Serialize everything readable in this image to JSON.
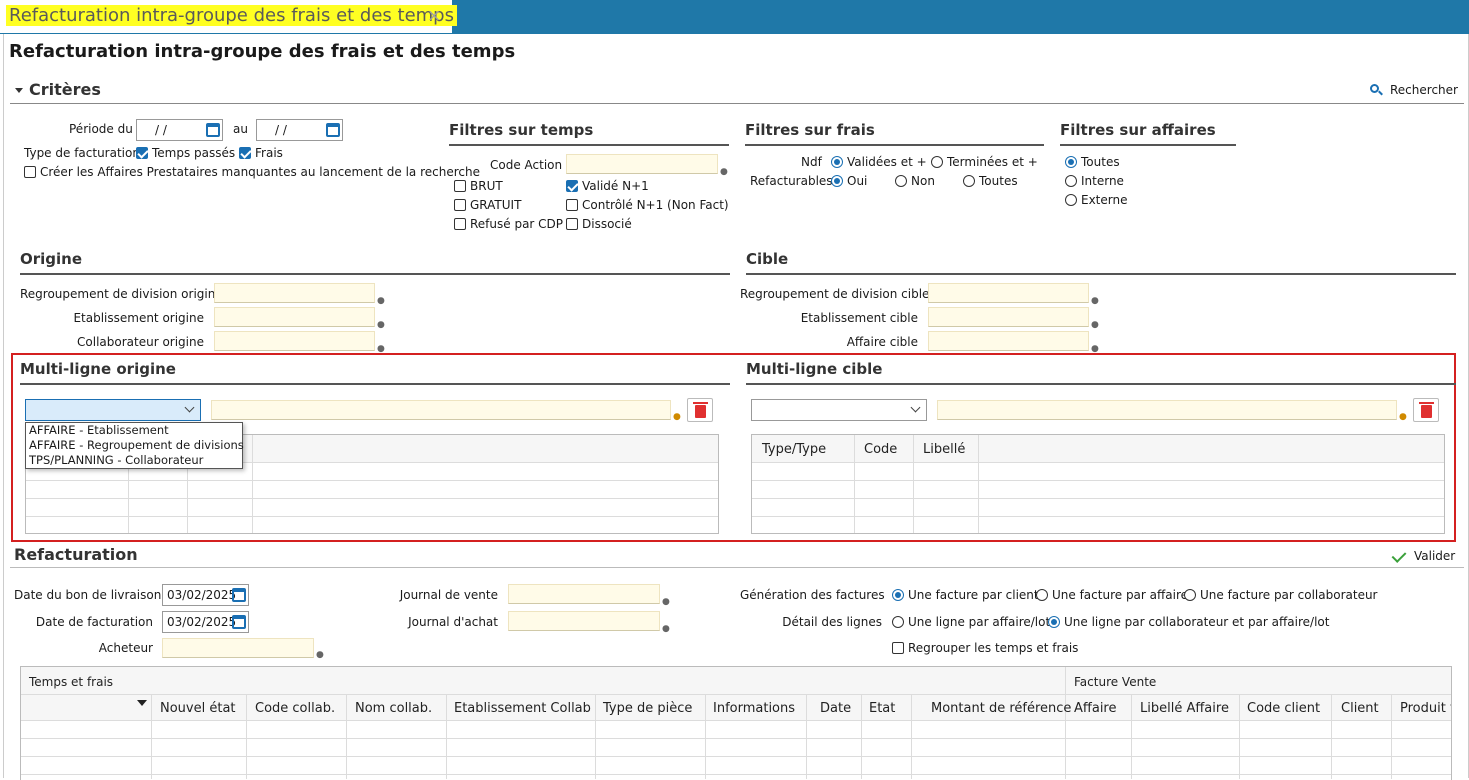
{
  "tab": {
    "label": "Refacturation intra-groupe des frais et des temps",
    "close": "×"
  },
  "page_title": "Refacturation intra-groupe des frais et des temps",
  "criteres": {
    "title": "Critères",
    "search_label": "Rechercher",
    "periode_label": "Période du",
    "periode_from": " /  / ",
    "au_label": "au",
    "periode_to": " /  / ",
    "type_fact_label": "Type de facturation",
    "temps_passes": "Temps passés",
    "frais": "Frais",
    "creer_affaires": "Créer les Affaires Prestataires manquantes au lancement de la recherche"
  },
  "filtres_temps": {
    "title": "Filtres sur temps",
    "code_action": "Code Action",
    "brut": "BRUT",
    "gratuit": "GRATUIT",
    "refuse_cdp": "Refusé par CDP",
    "valide_n1": "Validé N+1",
    "controle_n1": "Contrôlé N+1 (Non Fact)",
    "dissocie": "Dissocié"
  },
  "filtres_frais": {
    "title": "Filtres sur frais",
    "ndf": "Ndf",
    "refacturables": "Refacturables",
    "validees": "Validées et +",
    "terminees": "Terminées et +",
    "oui": "Oui",
    "non": "Non",
    "toutes": "Toutes"
  },
  "filtres_affaires": {
    "title": "Filtres sur affaires",
    "toutes": "Toutes",
    "interne": "Interne",
    "externe": "Externe"
  },
  "origine": {
    "title": "Origine",
    "regroupement": "Regroupement de division origine",
    "etablissement": "Etablissement origine",
    "collaborateur": "Collaborateur origine"
  },
  "cible": {
    "title": "Cible",
    "regroupement": "Regroupement de division cible",
    "etablissement": "Etablissement cible",
    "affaire": "Affaire cible"
  },
  "multi_origine": {
    "title": "Multi-ligne origine",
    "options": [
      "AFFAIRE - Etablissement",
      "AFFAIRE - Regroupement de divisions",
      "TPS/PLANNING - Collaborateur"
    ]
  },
  "multi_cible": {
    "title": "Multi-ligne cible",
    "columns": [
      "Type/Type",
      "Code",
      "Libellé"
    ]
  },
  "refacturation": {
    "title": "Refacturation",
    "valider": "Valider",
    "date_bl_label": "Date du bon de livraison",
    "date_bl": "03/02/2025",
    "date_fact_label": "Date de facturation",
    "date_fact": "03/02/2025",
    "acheteur": "Acheteur",
    "journal_vente": "Journal de vente",
    "journal_achat": "Journal d'achat",
    "generation_label": "Génération des factures",
    "gen_client": "Une facture par client",
    "gen_affaire": "Une facture par affaire",
    "gen_collab": "Une facture par collaborateur",
    "detail_label": "Détail des lignes",
    "detail_affaire": "Une ligne par affaire/lot",
    "detail_collab": "Une ligne par collaborateur et par affaire/lot",
    "regrouper": "Regrouper les temps et frais"
  },
  "bottom_grid": {
    "group_left": "Temps et frais",
    "group_right": "Facture Vente",
    "columns": [
      "Nouvel état",
      "Code collab.",
      "Nom collab.",
      "Etablissement Collab",
      "Type de pièce",
      "Informations",
      "Date",
      "Etat",
      "Montant de référence",
      "Affaire",
      "Libellé Affaire",
      "Code client",
      "Client",
      "Produit v"
    ]
  }
}
